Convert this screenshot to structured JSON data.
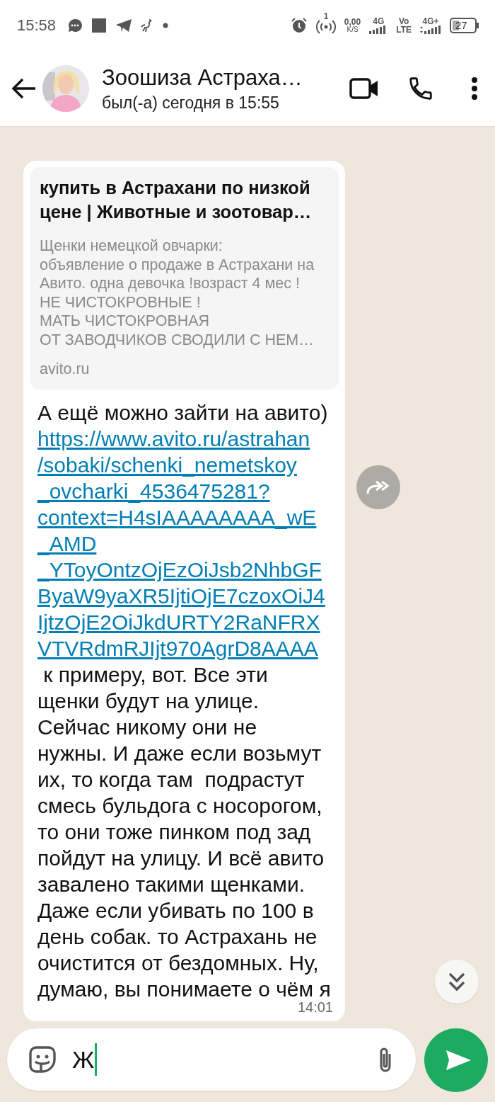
{
  "status_bar": {
    "time": "15:58",
    "hotspot_count": "1",
    "net_speed": "0,00",
    "net_speed_unit": "K/S",
    "network_1": "4G",
    "volte_top": "Vo",
    "volte_bottom": "LTE",
    "network_2": "4G+",
    "battery": "27"
  },
  "header": {
    "name": "Зоошиза Астраха…",
    "status": "был(-а) сегодня в 15:55"
  },
  "message": {
    "preview": {
      "title": "купить в Астрахани по низкой цене | Животные и зоотовар…",
      "description": "Щенки немецкой овчарки:\nобъявление о продаже в Астрахани на Авито. одна девочка !возраст 4 мес ! НЕ ЧИСТОКРОВНЫЕ !\nМАТЬ ЧИСТОКРОВНАЯ\nОТ ЗАВОДЧИКОВ СВОДИЛИ С НЕМ…",
      "domain": "avito.ru"
    },
    "text_before": "А ещё можно зайти на авито) ",
    "link": "https://www.avito.ru/astrahan/sobaki/schenki_nemetskoy_ovcharki_4536475281?context=H4sIAAAAAAAA_wE_AMD_YToyOntzOjEzOiJsb2NhbGFByaW9yaXR5IjtiOjE7czoxOiJ4IjtzOjE2OiJkdURTY2RaNFRXVTVRdmRJIjt970AgrD8AAAA",
    "text_after": " к примеру, вот. Все эти щенки будут на улице. Сейчас никому они не нужны. И даже если возьмут их, то когда там  подрастут смесь бульдога с носорогом, то они тоже пинком под зад пойдут на улицу. И всё авито завалено такими щенками. Даже если убивать по 100 в день собак. то Астрахань не очистится от бездомных. Ну, думаю, вы понимаете о чём я",
    "time": "14:01"
  },
  "composer": {
    "value": "Ж"
  }
}
